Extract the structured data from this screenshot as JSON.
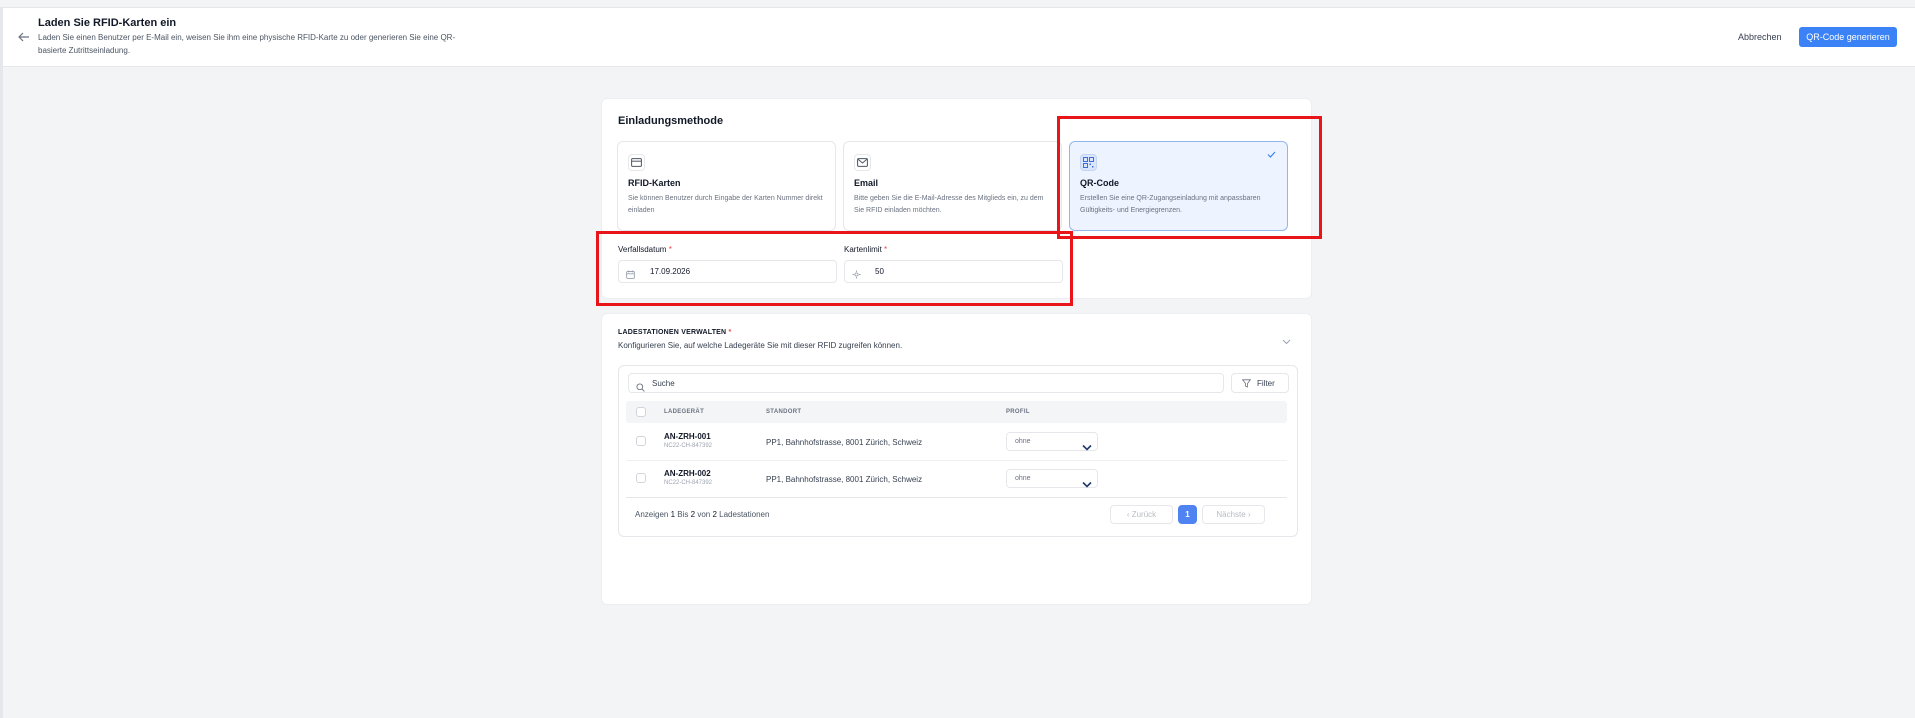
{
  "header": {
    "back_icon": "arrow-left-icon",
    "title": "Laden Sie RFID-Karten ein",
    "subtitle": "Laden Sie einen Benutzer per E-Mail ein, weisen Sie ihm eine physische RFID-Karte zu oder generieren Sie eine QR-basierte Zutrittseinladung.",
    "cancel_label": "Abbrechen",
    "primary_label": "QR-Code generieren"
  },
  "invite": {
    "section_title": "Einladungsmethode",
    "options": [
      {
        "title": "RFID-Karten",
        "desc": "Sie können Benutzer durch Eingabe der Karten Nummer direkt einladen",
        "icon": "credit-card-icon",
        "selected": false
      },
      {
        "title": "Email",
        "desc": "Bitte geben Sie die E-Mail-Adresse des Mitglieds ein, zu dem Sie RFID einladen möchten.",
        "icon": "mail-icon",
        "selected": false
      },
      {
        "title": "QR-Code",
        "desc": "Erstellen Sie eine QR-Zugangseinladung mit anpassbaren Gültigkeits- und Energiegrenzen.",
        "icon": "qr-code-icon",
        "selected": true
      }
    ],
    "expiry_label": "Verfallsdatum",
    "expiry_value": "17.09.2026",
    "limit_label": "Kartenlimit",
    "limit_value": "50",
    "required_mark": "*"
  },
  "stations": {
    "title": "LADESTATIONEN VERWALTEN",
    "required_mark": "*",
    "subtitle": "Konfigurieren Sie, auf welche Ladegeräte Sie mit dieser RFID zugreifen können.",
    "search_placeholder": "Suche",
    "filter_label": "Filter",
    "columns": {
      "charger": "LADEGERÄT",
      "location": "STANDORT",
      "profile": "PROFIL"
    },
    "rows": [
      {
        "name": "AN-ZRH-001",
        "serial": "NC22-CH-847392",
        "location": "PP1, Bahnhofstrasse, 8001 Zürich, Schweiz",
        "profile": "ohne"
      },
      {
        "name": "AN-ZRH-002",
        "serial": "NC22-CH-847392",
        "location": "PP1, Bahnhofstrasse, 8001 Zürich, Schweiz",
        "profile": "ohne"
      }
    ],
    "summary": {
      "prefix": "Anzeigen",
      "from": "1",
      "bis": "Bis",
      "to": "2",
      "von": "von",
      "total": "2",
      "suffix": "Ladestationen"
    },
    "pagination": {
      "prev": "‹  Zurück",
      "page": "1",
      "next": "Nächste  ›"
    }
  },
  "colors": {
    "accent": "#3b82f6",
    "highlight": "#e8161b",
    "required": "#ef4444"
  }
}
